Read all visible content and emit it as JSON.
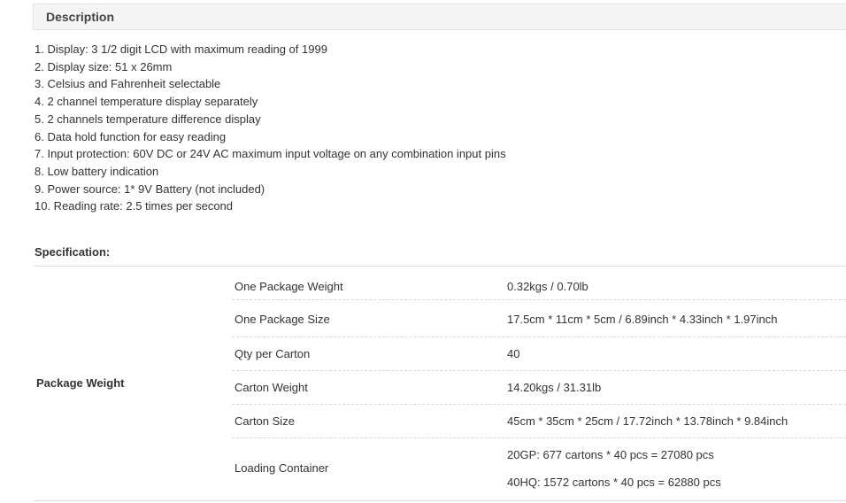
{
  "description": {
    "header": "Description",
    "items": [
      "1. Display: 3 1/2 digit LCD with maximum reading of 1999",
      "2. Display size: 51 x 26mm",
      "3. Celsius and Fahrenheit selectable",
      "4. 2 channel temperature display separately",
      "5. 2 channels temperature difference display",
      "6. Data hold function for easy reading",
      "7. Input protection: 60V DC or 24V AC maximum input voltage on any combination input pins",
      "8. Low battery indication",
      "9. Power source: 1* 9V Battery (not included)",
      "10. Reading rate: 2.5 times per second"
    ]
  },
  "specification": {
    "title": "Specification:",
    "group_label": "Package Weight",
    "rows": [
      {
        "key": "One Package Weight",
        "values": [
          "0.32kgs / 0.70lb"
        ]
      },
      {
        "key": "One Package Size",
        "values": [
          "17.5cm * 11cm * 5cm / 6.89inch * 4.33inch * 1.97inch"
        ]
      },
      {
        "key": "Qty per Carton",
        "values": [
          "40"
        ]
      },
      {
        "key": "Carton Weight",
        "values": [
          "14.20kgs / 31.31lb"
        ]
      },
      {
        "key": "Carton Size",
        "values": [
          "45cm * 35cm * 25cm / 17.72inch * 13.78inch * 9.84inch"
        ]
      },
      {
        "key": "Loading Container",
        "values": [
          "20GP: 677 cartons * 40 pcs = 27080 pcs",
          "40HQ: 1572 cartons * 40 pcs = 62880 pcs"
        ]
      }
    ]
  }
}
